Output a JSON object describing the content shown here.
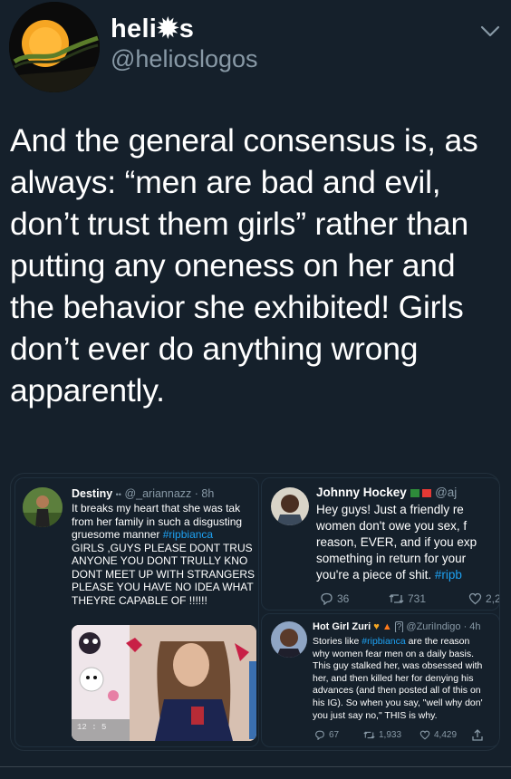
{
  "account": {
    "name": "heli✹s",
    "handle": "@helioslogos"
  },
  "tweet": {
    "text": "And the general consensus is, as always: “men are bad and evil, don’t trust them girls” rather than putting any oneness on her and the behavior she exhibited! Girls don’t ever do anything wrong apparently."
  },
  "embedded": {
    "left": {
      "name": "Destiny",
      "handle": "@_ariannazz",
      "time": "· 8h",
      "line1": "It breaks my heart that she was tak",
      "line2": "from her family in such a disgusting",
      "line3_pre": "gruesome manner ",
      "line3_tag": "#ripbianca",
      "caps": [
        "GIRLS ,GUYS PLEASE DONT TRUS",
        "ANYONE YOU DONT TRULLY KNO",
        "DONT MEET UP WITH STRANGERS",
        "PLEASE YOU HAVE NO IDEA WHAT",
        "THEYRE CAPABLE OF !!!!!!"
      ],
      "clock": "12 : 5"
    },
    "right_top": {
      "name": "Johnny Hockey",
      "handle": "@aj",
      "lines": [
        "Hey guys!  Just a friendly re",
        "women don't owe you sex, f",
        "reason, EVER, and if you exp",
        "something in return for your"
      ],
      "last_pre": "you're a piece of shit. ",
      "last_tag": "#ripb",
      "replies": "36",
      "retweets": "731",
      "likes": "2,2"
    },
    "right_bottom": {
      "name": "Hot Girl Zuri",
      "handle": "@ZuriIndigo",
      "time": "· 4h",
      "line1_pre": "Stories like ",
      "line1_tag": "#ripbianca",
      "line1_post": " are the reason",
      "lines": [
        "why women fear men on a daily basis.",
        "This guy stalked her, was obsessed with",
        "her, and then killed her for denying his",
        "advances (and then posted all of this on",
        "his IG). So when you say, \"well why don'",
        "you just say no,\" THIS is why."
      ],
      "replies": "67",
      "retweets": "1,933",
      "likes": "4,429"
    }
  },
  "colors": {
    "background": "#15202b",
    "secondary_text": "#8899a6",
    "link": "#1da1f2"
  }
}
